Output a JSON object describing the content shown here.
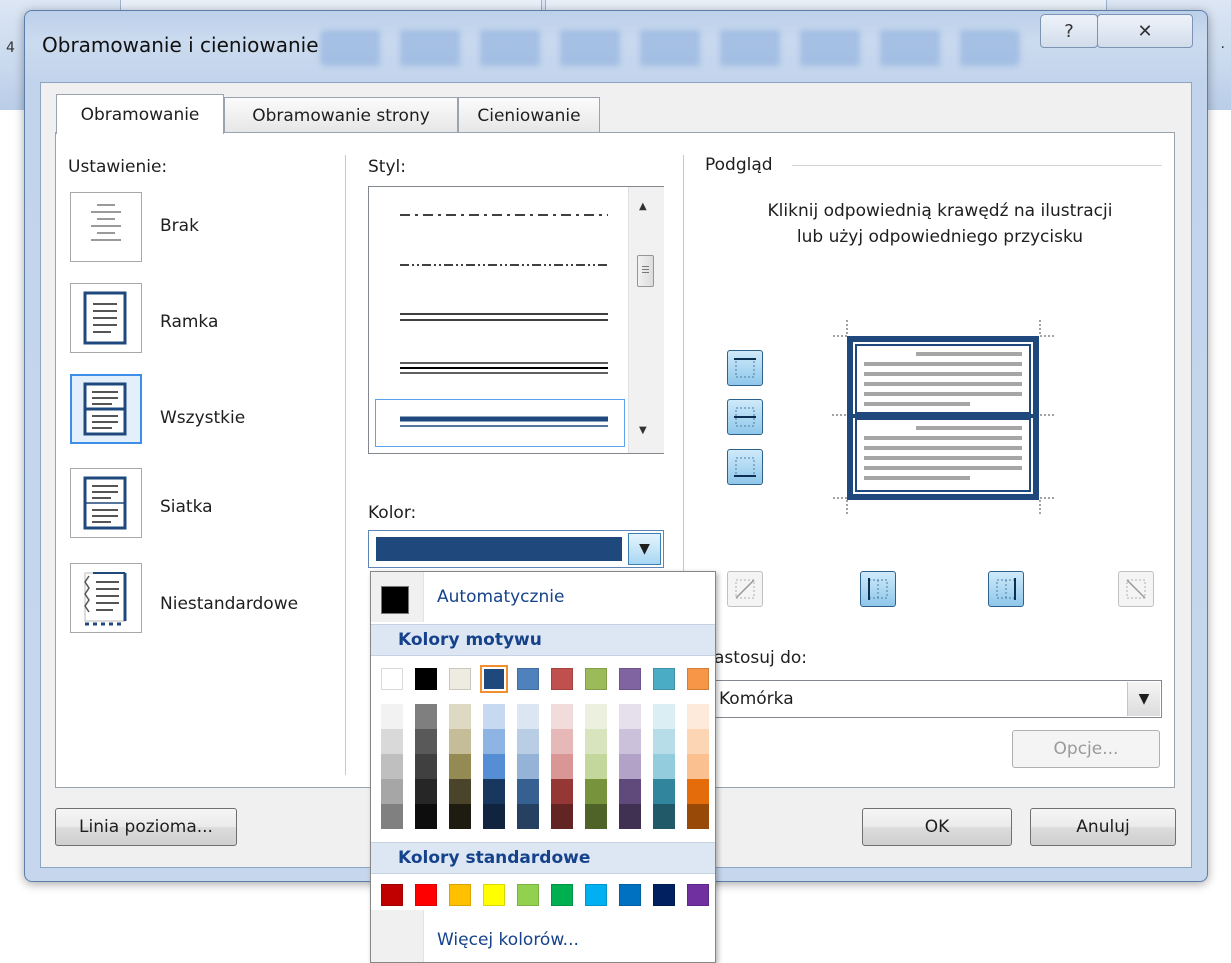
{
  "window": {
    "title": "Obramowanie i cieniowanie",
    "help_glyph": "?",
    "close_glyph": "✕"
  },
  "background": {
    "left_char": "4",
    "right_char": "·"
  },
  "tabs": [
    {
      "label": "Obramowanie",
      "active": true
    },
    {
      "label": "Obramowanie strony",
      "active": false
    },
    {
      "label": "Cieniowanie",
      "active": false
    }
  ],
  "setting": {
    "label": "Ustawienie:",
    "items": [
      {
        "label": "Brak"
      },
      {
        "label": "Ramka"
      },
      {
        "label": "Wszystkie"
      },
      {
        "label": "Siatka"
      },
      {
        "label": "Niestandardowe"
      }
    ]
  },
  "style": {
    "label": "Styl:",
    "scroll_up": "▲",
    "scroll_down": "▼"
  },
  "color": {
    "label": "Kolor:",
    "value_color": "#1f497d",
    "arrow": "▼"
  },
  "preview": {
    "title": "Podgląd",
    "hint": "Kliknij odpowiednią krawędź na ilustracji lub użyj odpowiedniego przycisku"
  },
  "apply": {
    "label": "astosuj do:",
    "value": "Komórka",
    "arrow": "▼"
  },
  "buttons": {
    "options": "Opcje...",
    "horizontal_line": "Linia pozioma...",
    "ok": "OK",
    "cancel": "Anuluj"
  },
  "color_menu": {
    "automatic": "Automatycznie",
    "theme_header": "Kolory motywu",
    "standard_header": "Kolory standardowe",
    "more_colors": "Więcej kolorów...",
    "theme_colors": [
      "#ffffff",
      "#000000",
      "#eeece1",
      "#1f497d",
      "#4f81bd",
      "#c0504d",
      "#9bbb59",
      "#8064a2",
      "#4bacc6",
      "#f79646"
    ],
    "selected_theme_index": 3,
    "theme_tints": [
      [
        "#f2f2f2",
        "#d9d9d9",
        "#bfbfbf",
        "#a6a6a6",
        "#808080"
      ],
      [
        "#7f7f7f",
        "#595959",
        "#404040",
        "#262626",
        "#0d0d0d"
      ],
      [
        "#ddd9c3",
        "#c4bd97",
        "#948a54",
        "#4a452a",
        "#1e1c11"
      ],
      [
        "#c6d9f1",
        "#8eb4e3",
        "#558ed5",
        "#17375e",
        "#10243f"
      ],
      [
        "#dce6f2",
        "#b9cde5",
        "#95b3d7",
        "#376092",
        "#254061"
      ],
      [
        "#f2dcdb",
        "#e6b9b8",
        "#d99694",
        "#953735",
        "#632523"
      ],
      [
        "#ebf1de",
        "#d7e4bd",
        "#c3d69b",
        "#77933c",
        "#4f6228"
      ],
      [
        "#e6e0ec",
        "#ccc1da",
        "#b3a2c7",
        "#604a7b",
        "#403152"
      ],
      [
        "#dbeef4",
        "#b7dee8",
        "#93cddd",
        "#31859c",
        "#215968"
      ],
      [
        "#fdeada",
        "#fcd5b5",
        "#fac090",
        "#e46c0a",
        "#984807"
      ]
    ],
    "standard_colors": [
      "#c00000",
      "#ff0000",
      "#ffc000",
      "#ffff00",
      "#92d050",
      "#00b050",
      "#00b0f0",
      "#0070c0",
      "#002060",
      "#7030a0"
    ]
  }
}
